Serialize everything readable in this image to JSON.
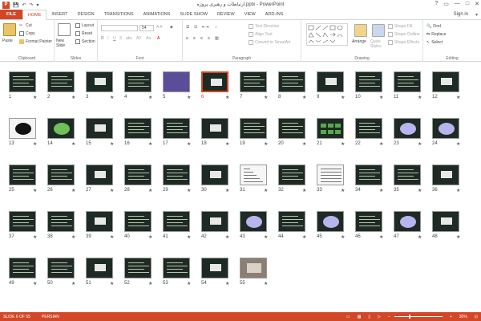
{
  "window": {
    "title": "ارتباطات و رهبری پروژه.pptx - PowerPoint",
    "controls": [
      "?",
      "▭",
      "—",
      "□",
      "✕"
    ]
  },
  "qat": {
    "save": "💾",
    "undo": "↶",
    "redo": "↷",
    "customize": "▾"
  },
  "tabs": [
    {
      "label": "FILE",
      "kind": "file"
    },
    {
      "label": "HOME",
      "kind": "active"
    },
    {
      "label": "INSERT",
      "kind": ""
    },
    {
      "label": "DESIGN",
      "kind": ""
    },
    {
      "label": "TRANSITIONS",
      "kind": ""
    },
    {
      "label": "ANIMATIONS",
      "kind": ""
    },
    {
      "label": "SLIDE SHOW",
      "kind": ""
    },
    {
      "label": "REVIEW",
      "kind": ""
    },
    {
      "label": "VIEW",
      "kind": ""
    },
    {
      "label": "ADD-INS",
      "kind": ""
    }
  ],
  "signin": "Sign in",
  "ribbon": {
    "clipboard": {
      "label": "Clipboard",
      "paste": "Paste",
      "cut": "Cut",
      "copy": "Copy",
      "format_painter": "Format Painter"
    },
    "slides": {
      "label": "Slides",
      "new_slide": "New Slide",
      "layout": "Layout",
      "reset": "Reset",
      "section": "Section"
    },
    "font": {
      "label": "Font",
      "font_name": "",
      "font_size": "54"
    },
    "paragraph": {
      "label": "Paragraph",
      "text_direction": "Text Direction",
      "align_text": "Align Text",
      "convert_smartart": "Convert to SmartArt"
    },
    "drawing": {
      "label": "Drawing",
      "arrange": "Arrange",
      "quick_styles": "Quick Styles",
      "shape_fill": "Shape Fill",
      "shape_outline": "Shape Outline",
      "shape_effects": "Shape Effects"
    },
    "editing": {
      "label": "Editing",
      "find": "Find",
      "replace": "Replace",
      "select": "Select"
    }
  },
  "slides": {
    "count": 55,
    "selected": 6,
    "star": "★",
    "special": {
      "5": "purple",
      "13": "black-oval",
      "14": "green-blob",
      "21": "green-boxes",
      "23": "purple-blob",
      "24": "purple-blob",
      "31": "chart",
      "33": "table",
      "43": "purple-blob",
      "45": "purple-blob",
      "47": "purple-blob",
      "55": "photo"
    }
  },
  "status": {
    "slide_info": "SLIDE 6 OF 55",
    "language": "PERSIAN",
    "zoom_label": "30%",
    "zoom_level": 0.3
  }
}
